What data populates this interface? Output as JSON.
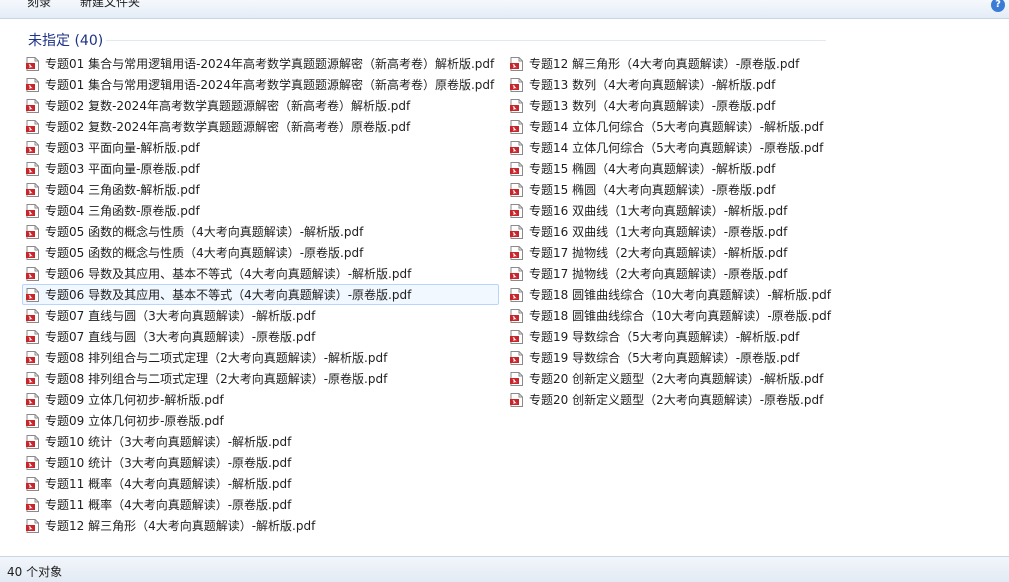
{
  "toolbar": {
    "burn_label": "刻录",
    "new_folder_label": "新建文件夹",
    "help_label": "?"
  },
  "group": {
    "title": "未指定 (40)"
  },
  "files_col1": [
    "专题01 集合与常用逻辑用语-2024年高考数学真题题源解密（新高考卷）解析版.pdf",
    "专题01 集合与常用逻辑用语-2024年高考数学真题题源解密（新高考卷）原卷版.pdf",
    "专题02 复数-2024年高考数学真题题源解密（新高考卷）解析版.pdf",
    "专题02 复数-2024年高考数学真题题源解密（新高考卷）原卷版.pdf",
    "专题03 平面向量-解析版.pdf",
    "专题03 平面向量-原卷版.pdf",
    "专题04 三角函数-解析版.pdf",
    "专题04 三角函数-原卷版.pdf",
    "专题05 函数的概念与性质（4大考向真题解读）-解析版.pdf",
    "专题05 函数的概念与性质（4大考向真题解读）-原卷版.pdf",
    "专题06 导数及其应用、基本不等式（4大考向真题解读）-解析版.pdf",
    "专题06 导数及其应用、基本不等式（4大考向真题解读）-原卷版.pdf",
    "专题07 直线与圆（3大考向真题解读）-解析版.pdf",
    "专题07 直线与圆（3大考向真题解读）-原卷版.pdf",
    "专题08 排列组合与二项式定理（2大考向真题解读）-解析版.pdf",
    "专题08 排列组合与二项式定理（2大考向真题解读）-原卷版.pdf",
    "专题09 立体几何初步-解析版.pdf",
    "专题09 立体几何初步-原卷版.pdf",
    "专题10 统计（3大考向真题解读）-解析版.pdf",
    "专题10 统计（3大考向真题解读）-原卷版.pdf",
    "专题11 概率（4大考向真题解读）-解析版.pdf",
    "专题11 概率（4大考向真题解读）-原卷版.pdf",
    "专题12 解三角形（4大考向真题解读）-解析版.pdf"
  ],
  "files_col2": [
    "专题12 解三角形（4大考向真题解读）-原卷版.pdf",
    "专题13 数列（4大考向真题解读）-解析版.pdf",
    "专题13 数列（4大考向真题解读）-原卷版.pdf",
    "专题14 立体几何综合（5大考向真题解读）-解析版.pdf",
    "专题14 立体几何综合（5大考向真题解读）-原卷版.pdf",
    "专题15 椭圆（4大考向真题解读）-解析版.pdf",
    "专题15 椭圆（4大考向真题解读）-原卷版.pdf",
    "专题16 双曲线（1大考向真题解读）-解析版.pdf",
    "专题16 双曲线（1大考向真题解读）-原卷版.pdf",
    "专题17 抛物线（2大考向真题解读）-解析版.pdf",
    "专题17 抛物线（2大考向真题解读）-原卷版.pdf",
    "专题18 圆锥曲线综合（10大考向真题解读）-解析版.pdf",
    "专题18 圆锥曲线综合（10大考向真题解读）-原卷版.pdf",
    "专题19 导数综合（5大考向真题解读）-解析版.pdf",
    "专题19 导数综合（5大考向真题解读）-原卷版.pdf",
    "专题20 创新定义题型（2大考向真题解读）-解析版.pdf",
    "专题20 创新定义题型（2大考向真题解读）-原卷版.pdf"
  ],
  "selected_file": "专题06 导数及其应用、基本不等式（4大考向真题解读）-原卷版.pdf",
  "file_icon": "pdf-file-icon",
  "colors": {
    "group_title": "#1e3287",
    "selection_border": "#b8d6fb",
    "pdf_red": "#c8262b"
  },
  "status": {
    "count_text": "40 个对象"
  }
}
